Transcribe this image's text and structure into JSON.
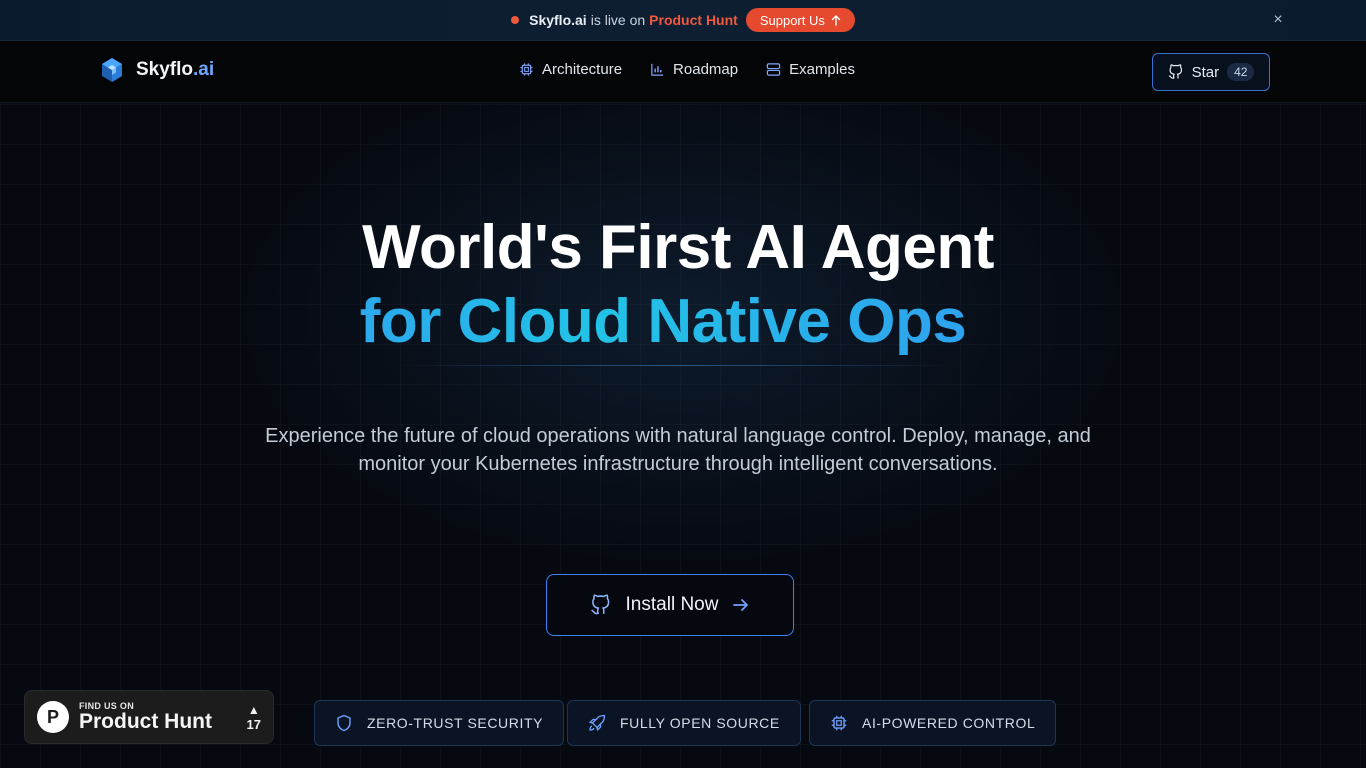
{
  "announcement": {
    "brand": "Skyflo.ai",
    "middle": "is live on",
    "product_hunt": "Product Hunt",
    "support_label": "Support Us",
    "close_glyph": "×"
  },
  "nav": {
    "logo_main": "Skyflo",
    "logo_suffix": ".ai",
    "links": [
      {
        "label": "Architecture",
        "icon": "cpu-icon"
      },
      {
        "label": "Roadmap",
        "icon": "bar-chart-icon"
      },
      {
        "label": "Examples",
        "icon": "server-icon"
      }
    ],
    "star_label": "Star",
    "star_count": "42"
  },
  "hero": {
    "title_line1": "World's First AI Agent",
    "title_line2": "for Cloud Native Ops",
    "subtitle": "Experience the future of cloud operations with natural language control. Deploy, manage, and monitor your Kubernetes infrastructure through intelligent conversations.",
    "install_label": "Install Now"
  },
  "badges": [
    {
      "label": "ZERO-TRUST SECURITY",
      "icon": "shield-icon"
    },
    {
      "label": "FULLY OPEN SOURCE",
      "icon": "rocket-icon"
    },
    {
      "label": "AI-POWERED CONTROL",
      "icon": "cpu-icon"
    }
  ],
  "product_hunt_widget": {
    "logo_letter": "P",
    "small_text": "FIND US ON",
    "big_text": "Product Hunt",
    "vote_arrow": "▲",
    "votes": "17"
  },
  "colors": {
    "accent_blue": "#3b82f6",
    "accent_cyan": "#22c3e6",
    "product_hunt_orange": "#f0593b",
    "background": "#060910"
  }
}
